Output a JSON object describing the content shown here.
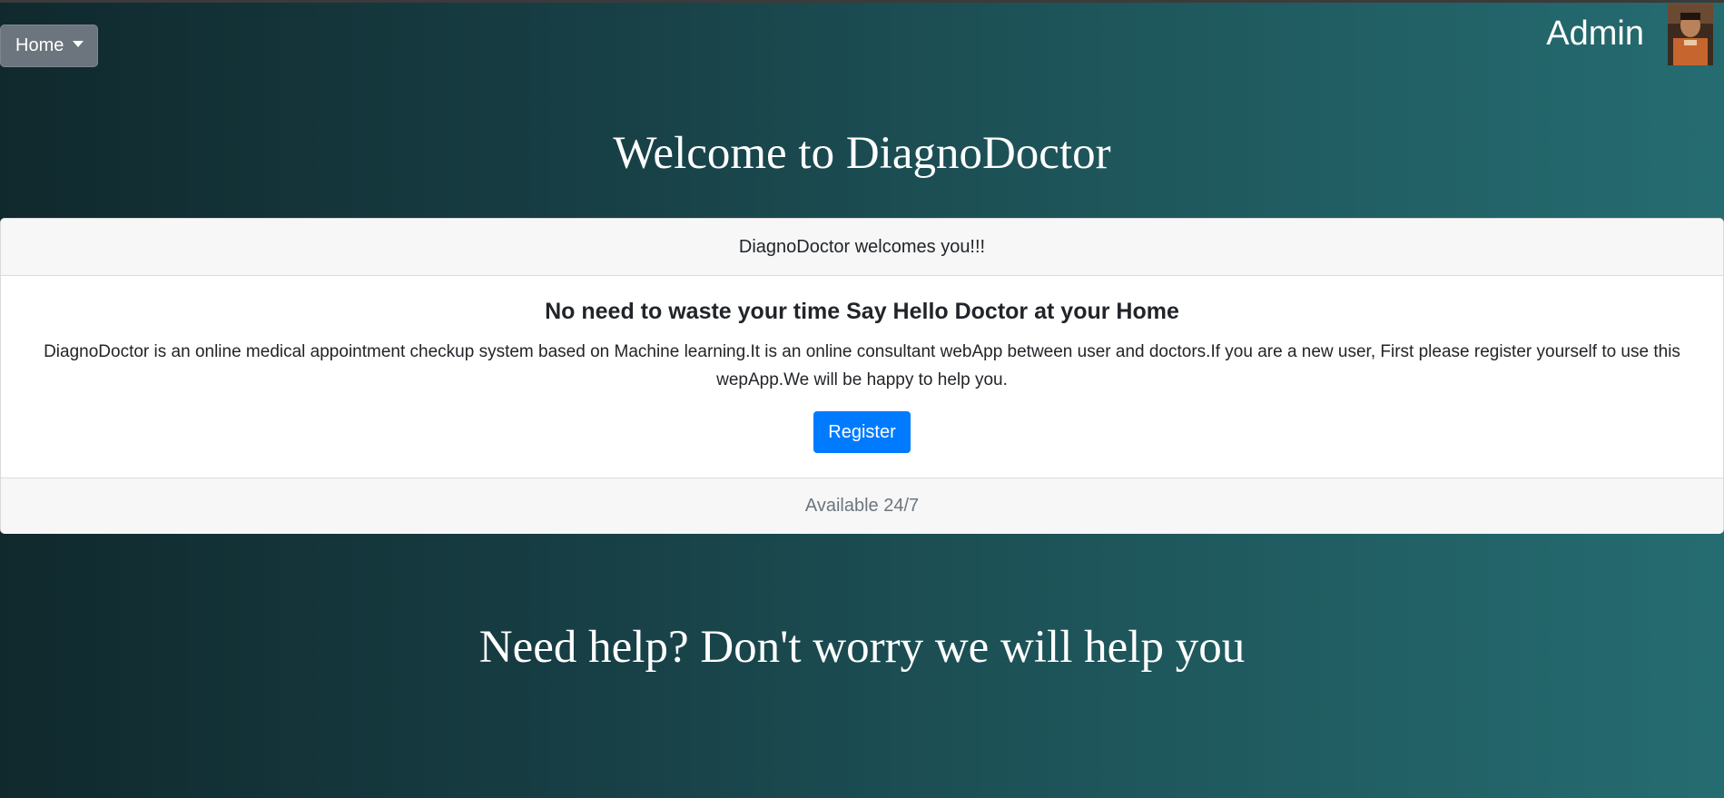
{
  "nav": {
    "home_label": "Home",
    "user_name": "Admin"
  },
  "main": {
    "title": "Welcome to DiagnoDoctor",
    "card": {
      "header": "DiagnoDoctor welcomes you!!!",
      "title": "No need to waste your time Say Hello Doctor at your Home",
      "text": "DiagnoDoctor is an online medical appointment checkup system based on Machine learning.It is an online consultant webApp between user and doctors.If you are a new user, First please register yourself to use this wepApp.We will be happy to help you.",
      "button_label": "Register",
      "footer": "Available 24/7"
    },
    "help_title": "Need help? Don't worry we will help you"
  },
  "colors": {
    "primary_button": "#007bff",
    "secondary_button": "#6c757d",
    "background_start": "#10292d",
    "background_end": "#256c71"
  }
}
